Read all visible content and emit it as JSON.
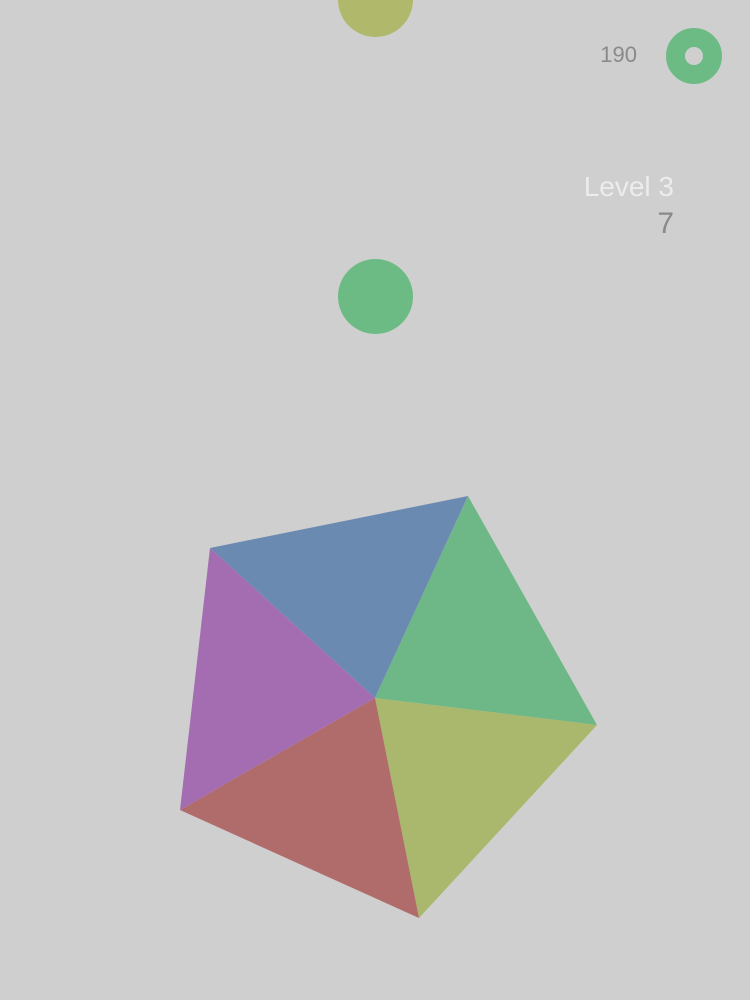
{
  "hud": {
    "score": "190",
    "level": "Level 3",
    "remaining": "7",
    "coin_icon": "ring-coin-icon"
  },
  "balls": [
    {
      "name": "falling-ball-top",
      "color": "#b0b86b"
    },
    {
      "name": "falling-ball-middle",
      "color": "#6dbb84"
    }
  ],
  "wheel": {
    "segments": [
      {
        "name": "segment-blue",
        "color": "#6b8ab2"
      },
      {
        "name": "segment-green",
        "color": "#6db886"
      },
      {
        "name": "segment-yellow",
        "color": "#a9b86c"
      },
      {
        "name": "segment-red",
        "color": "#b06b6b"
      },
      {
        "name": "segment-purple",
        "color": "#a46db2"
      }
    ]
  },
  "colors": {
    "background": "#cfcfcf",
    "text_dark": "#8a8a8a",
    "text_light": "#ececec"
  }
}
